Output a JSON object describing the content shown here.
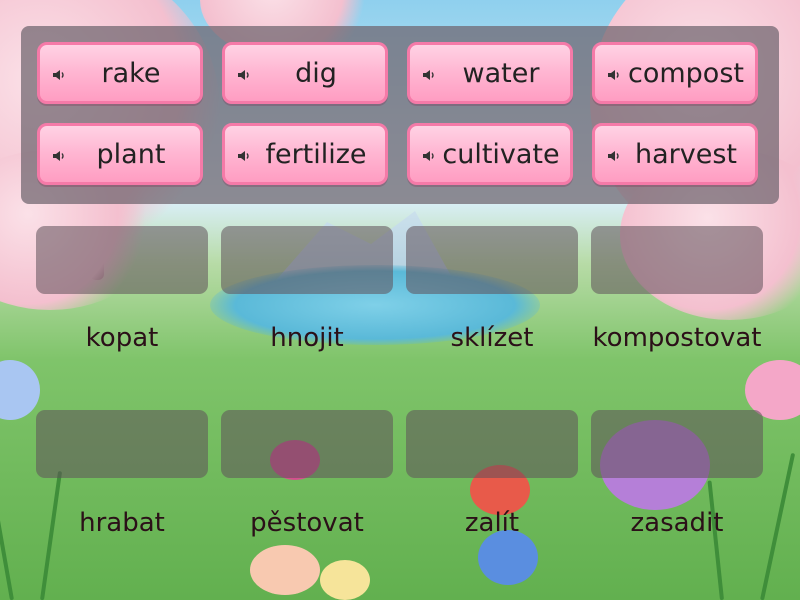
{
  "tiles": [
    {
      "word": "rake",
      "icon": "speaker-icon"
    },
    {
      "word": "dig",
      "icon": "speaker-icon"
    },
    {
      "word": "water",
      "icon": "speaker-icon"
    },
    {
      "word": "compost",
      "icon": "speaker-icon"
    },
    {
      "word": "plant",
      "icon": "speaker-icon"
    },
    {
      "word": "fertilize",
      "icon": "speaker-icon"
    },
    {
      "word": "cultivate",
      "icon": "speaker-icon"
    },
    {
      "word": "harvest",
      "icon": "speaker-icon"
    }
  ],
  "labels": [
    "kopat",
    "hnojit",
    "sklízet",
    "kompostovat",
    "hrabat",
    "pěstovat",
    "zalít",
    "zasadit"
  ],
  "colors": {
    "tile_fill": "#ffb6d2",
    "tile_border": "#f57aa8",
    "tray": "#6e646e",
    "slot": "#5f505a"
  }
}
